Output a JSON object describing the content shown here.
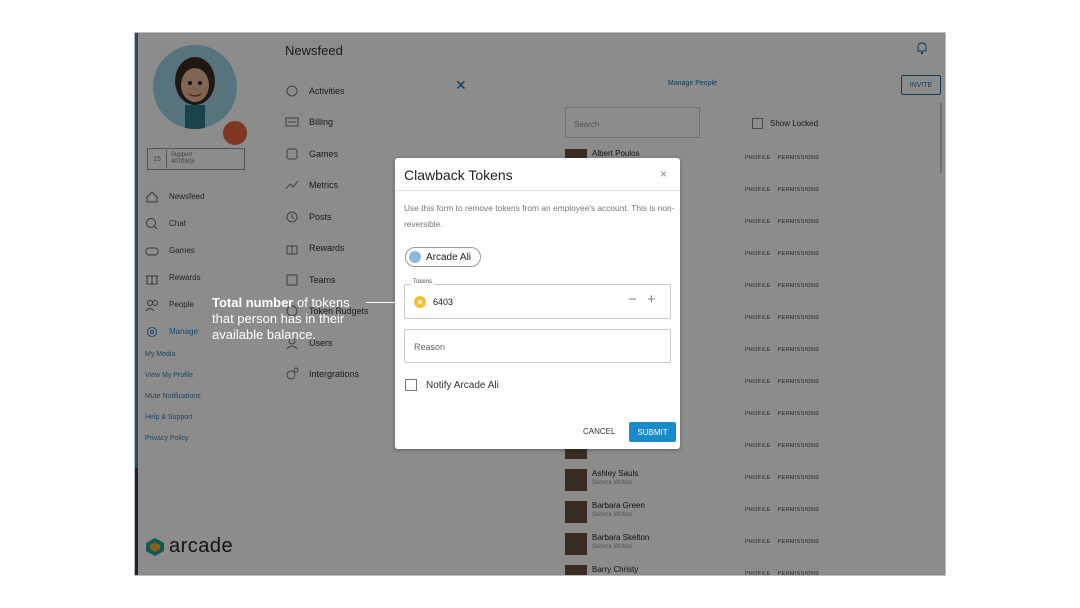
{
  "sidebar": {
    "support_number": "15",
    "support_label_1": "Support",
    "support_label_2": "4070903",
    "nav": [
      {
        "label": "Newsfeed",
        "icon": "home-icon"
      },
      {
        "label": "Chat",
        "icon": "chat-icon"
      },
      {
        "label": "Games",
        "icon": "gamepad-icon"
      },
      {
        "label": "Rewards",
        "icon": "gift-icon"
      },
      {
        "label": "People",
        "icon": "people-icon"
      },
      {
        "label": "Manage",
        "icon": "gear-icon"
      }
    ],
    "links": [
      "My Media",
      "View My Profile",
      "Mute Notifications",
      "Help & Support",
      "Privacy Policy"
    ],
    "logo_text": "arcade"
  },
  "manage_menu": {
    "title": "Newsfeed",
    "items": [
      "Activities",
      "Billing",
      "Games",
      "Metrics",
      "Posts",
      "Rewards",
      "Teams",
      "Token Budgets",
      "Users",
      "Intergrations"
    ]
  },
  "people_panel": {
    "manage_people": "Manage People",
    "invite": "INVITE",
    "search_placeholder": "Search",
    "show_locked": "Show Locked",
    "profile_label": "PROFILE",
    "permissions_label": "PERMISSIONS",
    "people": [
      {
        "name": "Albert Poulos",
        "role": ""
      },
      {
        "name": "",
        "role": ""
      },
      {
        "name": "",
        "role": ""
      },
      {
        "name": "",
        "role": ""
      },
      {
        "name": "",
        "role": ""
      },
      {
        "name": "",
        "role": ""
      },
      {
        "name": "",
        "role": ""
      },
      {
        "name": "",
        "role": ""
      },
      {
        "name": "",
        "role": ""
      },
      {
        "name": "",
        "role": ""
      },
      {
        "name": "Ashley Sauls",
        "role": "Service Writers"
      },
      {
        "name": "Barbara Green",
        "role": "Service Writers"
      },
      {
        "name": "Barbara Skelton",
        "role": "Service Writers"
      },
      {
        "name": "Barry Christy",
        "role": ""
      }
    ]
  },
  "modal": {
    "title": "Clawback Tokens",
    "close": "×",
    "description": "Use this form to remove tokens from an employee's account. This is non-reversible.",
    "recipient": "Arcade Ali",
    "tokens_label": "Tokens",
    "tokens_value": "6403",
    "minus": "−",
    "plus": "+",
    "reason_placeholder": "Reason",
    "notify_label": "Notify Arcade Ali",
    "cancel": "CANCEL",
    "submit": "SUBMIT"
  },
  "annotation": {
    "bold": "Total number",
    "rest": " of tokens that person has in their available balance."
  },
  "colors": {
    "accent": "#1a8bc9",
    "link": "#3a7fb0",
    "coin": "#f2c236",
    "badge": "#e8643c"
  }
}
